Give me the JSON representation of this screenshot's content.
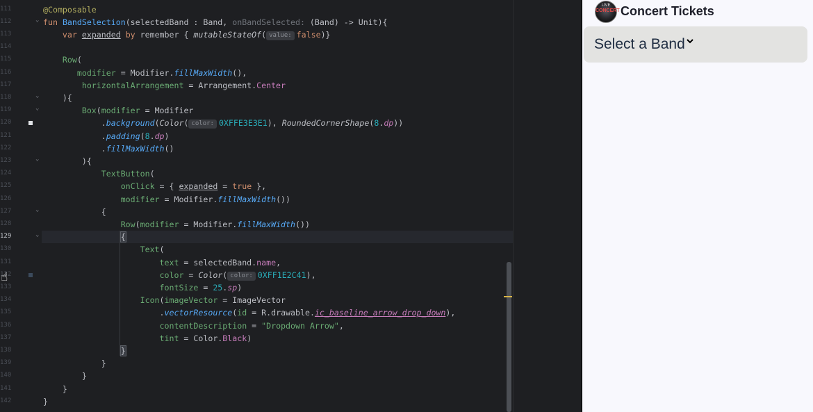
{
  "editor": {
    "active_line_index": 18,
    "lines": [
      {
        "n": "111",
        "html": "<span class=\"ann\">@Composable</span>"
      },
      {
        "n": "112",
        "html": "<span class=\"kw\">fun</span> <span class=\"fn\">BandSelection</span>(selectedBand : Band, <span class=\"prm\">onBandSelected:</span> (Band) -&gt; Unit){"
      },
      {
        "n": "113",
        "html": "    <span class=\"kw\">var</span> <span class=\"ul\">expanded</span> <span class=\"kw\">by</span> remember { <span class=\"it\">mutableStateOf</span>(<span class=\"hint\">value:</span><span class=\"kw\">false</span>)}"
      },
      {
        "n": "114",
        "html": ""
      },
      {
        "n": "115",
        "html": "    <span class=\"str\">Row</span>("
      },
      {
        "n": "116",
        "html": "       <span class=\"str\">modifier</span> = Modifier.<span class=\"call\">fillMaxWidth</span>(),"
      },
      {
        "n": "117",
        "html": "        <span class=\"str\">horizontalArrangement</span> = Arrangement.<span class=\"prop\">Center</span>"
      },
      {
        "n": "118",
        "html": "    ){"
      },
      {
        "n": "119",
        "html": "        <span class=\"str\">Box</span>(<span class=\"str\">modifier</span> = Modifier"
      },
      {
        "n": "120",
        "html": "            .<span class=\"call\">background</span>(<span class=\"it\">Color</span>(<span class=\"hint\">color:</span><span class=\"num\">0XFFE3E3E1</span>), <span class=\"it\">RoundedCornerShape</span>(<span class=\"num\">8</span>.<span class=\"prop it\">dp</span>))"
      },
      {
        "n": "121",
        "html": "            .<span class=\"call\">padding</span>(<span class=\"num\">8</span>.<span class=\"prop it\">dp</span>)"
      },
      {
        "n": "122",
        "html": "            .<span class=\"call\">fillMaxWidth</span>()"
      },
      {
        "n": "123",
        "html": "        ){"
      },
      {
        "n": "124",
        "html": "            <span class=\"str\">TextButton</span>("
      },
      {
        "n": "125",
        "html": "                <span class=\"str\">onClick</span> = { <span class=\"ul\">expanded</span> = <span class=\"kw\">true</span> },"
      },
      {
        "n": "126",
        "html": "                <span class=\"str\">modifier</span> = Modifier.<span class=\"call\">fillMaxWidth</span>())"
      },
      {
        "n": "127",
        "html": "            {"
      },
      {
        "n": "128",
        "html": "                <span class=\"str\">Row</span>(<span class=\"str\">modifier</span> = Modifier.<span class=\"call\">fillMaxWidth</span>())"
      },
      {
        "n": "129",
        "html": "                <span class=\"brace\">{</span>"
      },
      {
        "n": "130",
        "html": "                    <span class=\"str\">Text</span>("
      },
      {
        "n": "131",
        "html": "                        <span class=\"str\">text</span> = selectedBand.<span class=\"prop\">name</span>,"
      },
      {
        "n": "132",
        "html": "                        <span class=\"str\">color</span> = <span class=\"it\">Color</span>(<span class=\"hint\">color:</span><span class=\"num\">0XFF1E2C41</span>),"
      },
      {
        "n": "133",
        "html": "                        <span class=\"str\">fontSize</span> = <span class=\"num\">25</span>.<span class=\"prop it\">sp</span>)"
      },
      {
        "n": "134",
        "html": "                    <span class=\"str\">Icon</span>(<span class=\"str\">imageVector</span> = ImageVector"
      },
      {
        "n": "135",
        "html": "                        .<span class=\"call\">vectorResource</span>(<span class=\"str\">id</span> = R.drawable.<span class=\"lnk\">ic_baseline_arrow_drop_down</span>),"
      },
      {
        "n": "136",
        "html": "                        <span class=\"str\">contentDescription</span> = <span class=\"str\">\"Dropdown Arrow\"</span>,"
      },
      {
        "n": "137",
        "html": "                        <span class=\"str\">tint</span> = Color.<span class=\"prop\">Black</span>)"
      },
      {
        "n": "138",
        "html": "                <span class=\"brace\">}</span>"
      },
      {
        "n": "139",
        "html": "            }"
      },
      {
        "n": "140",
        "html": "        }"
      },
      {
        "n": "141",
        "html": "    }"
      },
      {
        "n": "142",
        "html": "}"
      }
    ]
  },
  "preview": {
    "app_title": "Concert Tickets",
    "logo_text": "CONCERT",
    "logo_top": "LIVE",
    "band_label": "Select a Band",
    "box_color": "#E3E3E1",
    "text_color": "#1E2C41"
  }
}
